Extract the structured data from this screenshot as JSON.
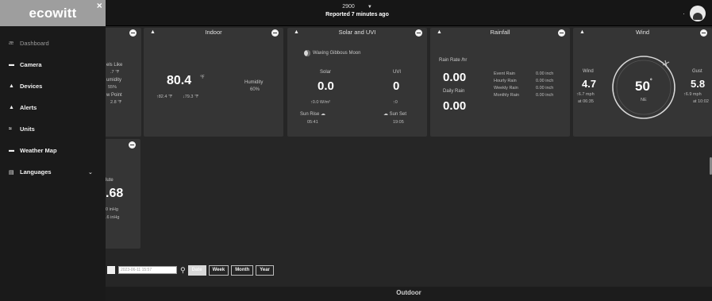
{
  "header": {
    "station_name": "2900",
    "reported": "Reported 7 minutes ago"
  },
  "sidebar": {
    "brand": "ecowitt",
    "items": [
      {
        "label": "Dashboard",
        "icon": "dashboard-icon",
        "glyph": "æ"
      },
      {
        "label": "Camera",
        "icon": "camera-icon",
        "glyph": "▬"
      },
      {
        "label": "Devices",
        "icon": "devices-icon",
        "glyph": "▲"
      },
      {
        "label": "Alerts",
        "icon": "bell-icon",
        "glyph": "▲"
      },
      {
        "label": "Units",
        "icon": "units-icon",
        "glyph": "≈"
      },
      {
        "label": "Weather Map",
        "icon": "map-icon",
        "glyph": "▬"
      },
      {
        "label": "Languages",
        "icon": "languages-icon",
        "glyph": "▤"
      }
    ]
  },
  "outdoor": {
    "feels_like_label": "els Like",
    "feels_like_value": ".7 ℉",
    "humidity_label": "umidity",
    "humidity_value": "55%",
    "dew_point_label": "w Point",
    "dew_point_value": "2.8 ℉"
  },
  "indoor": {
    "title": "Indoor",
    "temperature": "80.4",
    "temp_unit": "℉",
    "high": "↑82.4 ℉",
    "low": "↓79.3 ℉",
    "humidity_label": "Humidity",
    "humidity_value": "60%"
  },
  "solar": {
    "title": "Solar and UVI",
    "moon_phase": "Waxing Gibbous Moon",
    "solar_label": "Solar",
    "solar_value": "0.0",
    "solar_max": "↑0.0 W/m²",
    "uvi_label": "UVI",
    "uvi_value": "0",
    "uvi_max": "↑0",
    "sunrise_label": "Sun Rise",
    "sunrise_time": "05:41",
    "sunset_label": "Sun Set",
    "sunset_time": "19:05"
  },
  "rainfall": {
    "title": "Rainfall",
    "rate_label": "Rain Rate /hr",
    "rate_value": "0.00",
    "daily_label": "Daily Rain",
    "daily_value": "0.00",
    "rows": [
      {
        "label": "Event Rain",
        "value": "0.00 inch"
      },
      {
        "label": "Hourly Rain",
        "value": "0.00 inch"
      },
      {
        "label": "Weekly Rain",
        "value": "0.00 inch"
      },
      {
        "label": "Monthly Rain",
        "value": "0.00 inch"
      }
    ]
  },
  "wind": {
    "title": "Wind",
    "wind_label": "Wind",
    "wind_value": "4.7",
    "wind_max": "↑6.7 mph",
    "wind_time": "at 06:35",
    "direction_deg": "50",
    "direction_unit": "°",
    "direction_name": "NE",
    "gust_label": "Gust",
    "gust_value": "5.8",
    "gust_max": "↑6.9 mph",
    "gust_time": "at 10:02"
  },
  "pressure": {
    "label": "lute",
    "value": ".68",
    "line1": "0 inHg",
    "line2": ".6 inHg"
  },
  "toolbar": {
    "date_value": "2023-06-11 15:57",
    "buttons": [
      "Date",
      "Week",
      "Month",
      "Year"
    ]
  },
  "footer": {
    "outdoor_label": "Outdoor"
  }
}
